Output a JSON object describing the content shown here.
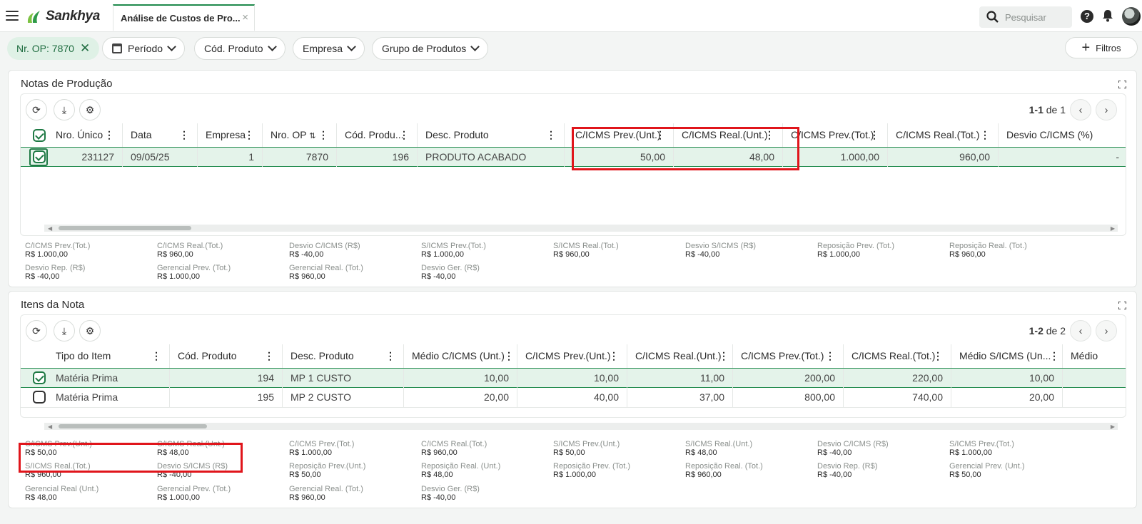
{
  "app": {
    "brand": "Sankhya",
    "tab_title": "Análise de Custos de Pro...",
    "tab_close": "×",
    "search_placeholder": "Pesquisar",
    "help": "?"
  },
  "filters": {
    "active_chip": "Nr. OP: 7870",
    "dropdowns": [
      "Período",
      "Cód. Produto",
      "Empresa",
      "Grupo de Produtos"
    ],
    "filtros_label": "Filtros"
  },
  "notas": {
    "title": "Notas de Produção",
    "pager": {
      "range": "1-1",
      "of": "de 1"
    },
    "columns": [
      "Nro. Único",
      "Data",
      "Empresa",
      "Nro. OP",
      "Cód. Produ...",
      "Desc. Produto",
      "C/ICMS Prev.(Unt.)",
      "C/ICMS Real.(Unt.)",
      "C/ICMS Prev.(Tot.)",
      "C/ICMS Real.(Tot.)",
      "Desvio C/ICMS (%)"
    ],
    "row": [
      "231127",
      "09/05/25",
      "1",
      "7870",
      "196",
      "PRODUTO ACABADO",
      "50,00",
      "48,00",
      "1.000,00",
      "960,00",
      "-"
    ],
    "totals": [
      {
        "label": "C/ICMS Prev.(Tot.)",
        "value": "R$ 1.000,00"
      },
      {
        "label": "C/ICMS Real.(Tot.)",
        "value": "R$ 960,00"
      },
      {
        "label": "Desvio C/ICMS (R$)",
        "value": "R$ -40,00"
      },
      {
        "label": "S/ICMS Prev.(Tot.)",
        "value": "R$ 1.000,00"
      },
      {
        "label": "S/ICMS Real.(Tot.)",
        "value": "R$ 960,00"
      },
      {
        "label": "Desvio S/ICMS (R$)",
        "value": "R$ -40,00"
      },
      {
        "label": "Reposição Prev. (Tot.)",
        "value": "R$ 1.000,00"
      },
      {
        "label": "Reposição Real. (Tot.)",
        "value": "R$ 960,00"
      },
      {
        "label": "Desvio Rep. (R$)",
        "value": "R$ -40,00"
      },
      {
        "label": "Gerencial Prev. (Tot.)",
        "value": "R$ 1.000,00"
      },
      {
        "label": "Gerencial Real. (Tot.)",
        "value": "R$ 960,00"
      },
      {
        "label": "Desvio Ger. (R$)",
        "value": "R$ -40,00"
      }
    ]
  },
  "itens": {
    "title": "Itens da Nota",
    "pager": {
      "range": "1-2",
      "of": "de 2"
    },
    "columns": [
      "Tipo do Item",
      "Cód. Produto",
      "Desc. Produto",
      "Médio C/ICMS (Unt.)",
      "C/ICMS Prev.(Unt.)",
      "C/ICMS Real.(Unt.)",
      "C/ICMS Prev.(Tot.)",
      "C/ICMS Real.(Tot.)",
      "Médio S/ICMS (Un...",
      "Médio"
    ],
    "rows": [
      [
        "Matéria Prima",
        "194",
        "MP 1 CUSTO",
        "10,00",
        "10,00",
        "11,00",
        "200,00",
        "220,00",
        "10,00"
      ],
      [
        "Matéria Prima",
        "195",
        "MP 2 CUSTO",
        "20,00",
        "40,00",
        "37,00",
        "800,00",
        "740,00",
        "20,00"
      ]
    ],
    "totals": [
      {
        "label": "C/ICMS Prev.(Unt.)",
        "value": "R$ 50,00"
      },
      {
        "label": "C/ICMS Real.(Unt.)",
        "value": "R$ 48,00"
      },
      {
        "label": "C/ICMS Prev.(Tot.)",
        "value": "R$ 1.000,00"
      },
      {
        "label": "C/ICMS Real.(Tot.)",
        "value": "R$ 960,00"
      },
      {
        "label": "S/ICMS Prev.(Unt.)",
        "value": "R$ 50,00"
      },
      {
        "label": "S/ICMS Real.(Unt.)",
        "value": "R$ 48,00"
      },
      {
        "label": "Desvio C/ICMS (R$)",
        "value": "R$ -40,00"
      },
      {
        "label": "S/ICMS Prev.(Tot.)",
        "value": "R$ 1.000,00"
      },
      {
        "label": "S/ICMS Real.(Tot.)",
        "value": "R$ 960,00"
      },
      {
        "label": "Desvio S/ICMS (R$)",
        "value": "R$ -40,00"
      },
      {
        "label": "Reposição Prev.(Unt.)",
        "value": "R$ 50,00"
      },
      {
        "label": "Reposição Real. (Unt.)",
        "value": "R$ 48,00"
      },
      {
        "label": "Reposição Prev. (Tot.)",
        "value": "R$ 1.000,00"
      },
      {
        "label": "Reposição Real. (Tot.)",
        "value": "R$ 960,00"
      },
      {
        "label": "Desvio Rep. (R$)",
        "value": "R$ -40,00"
      },
      {
        "label": "Gerencial Prev. (Unt.)",
        "value": "R$ 50,00"
      },
      {
        "label": "Gerencial Real (Unt.)",
        "value": "R$ 48,00"
      },
      {
        "label": "Gerencial Prev. (Tot.)",
        "value": "R$ 1.000,00"
      },
      {
        "label": "Gerencial Real. (Tot.)",
        "value": "R$ 960,00"
      },
      {
        "label": "Desvio Ger. (R$)",
        "value": "R$ -40,00"
      }
    ]
  },
  "colors": {
    "brand_green": "#1f8a4c",
    "selected_row": "#e4f3ea",
    "highlight_red": "#e0151b"
  }
}
